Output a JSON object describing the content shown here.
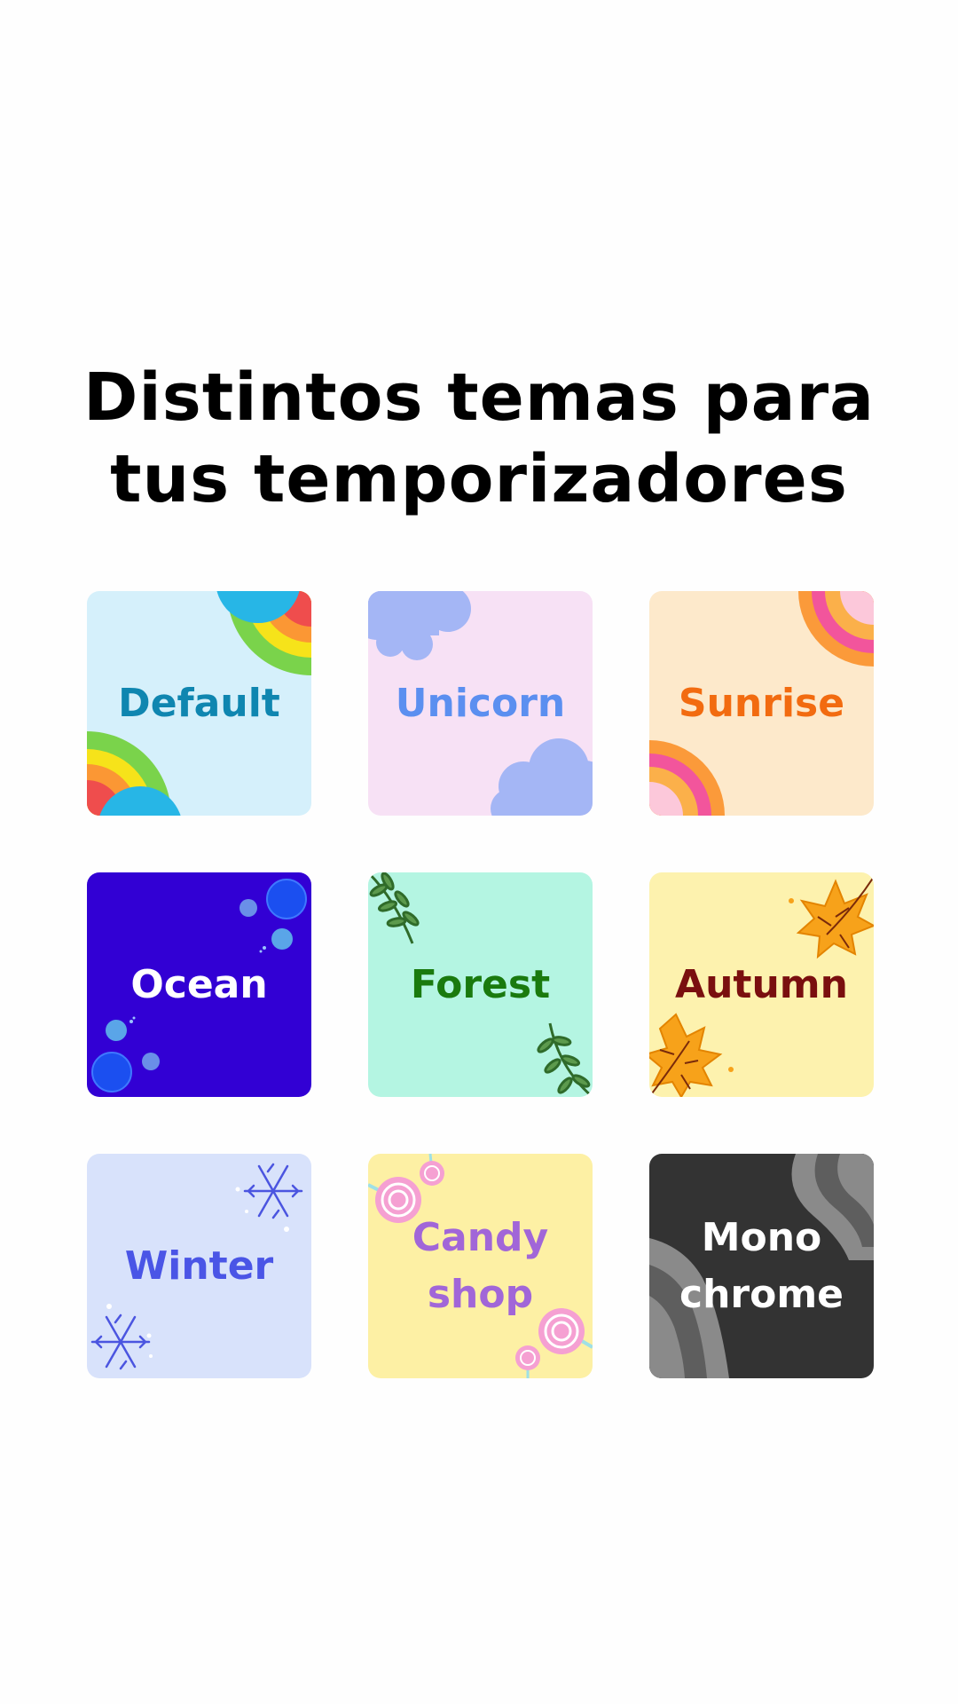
{
  "headline": {
    "line1": "Distintos temas para",
    "line2": "tus temporizadores"
  },
  "themes": [
    {
      "label": "Default",
      "bg": "#d5f0fb",
      "text_color": "#0f86b0",
      "icons": [
        "rainbow-bubble-icon"
      ]
    },
    {
      "label": "Unicorn",
      "bg": "#f7e1f5",
      "text_color": "#5b8ff0",
      "icons": [
        "cloud-icon"
      ]
    },
    {
      "label": "Sunrise",
      "bg": "#fde9cb",
      "text_color": "#f26b10",
      "icons": [
        "rainbow-arc-icon"
      ]
    },
    {
      "label": "Ocean",
      "bg": "#3200d4",
      "text_color": "#ffffff",
      "icons": [
        "bubble-icon"
      ]
    },
    {
      "label": "Forest",
      "bg": "#b4f5e2",
      "text_color": "#1a7a0e",
      "icons": [
        "fern-leaf-icon"
      ]
    },
    {
      "label": "Autumn",
      "bg": "#fdf2ae",
      "text_color": "#7a0f0f",
      "icons": [
        "maple-leaf-icon"
      ]
    },
    {
      "label": "Winter",
      "bg": "#d8e2fb",
      "text_color": "#4a55e6",
      "icons": [
        "snowflake-icon"
      ]
    },
    {
      "label": "Candy\nshop",
      "bg": "#fdf0a4",
      "text_color": "#a166d8",
      "icons": [
        "lollipop-icon"
      ]
    },
    {
      "label": "Mono\nchrome",
      "bg": "#333333",
      "text_color": "#ffffff",
      "icons": [
        "wave-stripes-icon"
      ]
    }
  ]
}
